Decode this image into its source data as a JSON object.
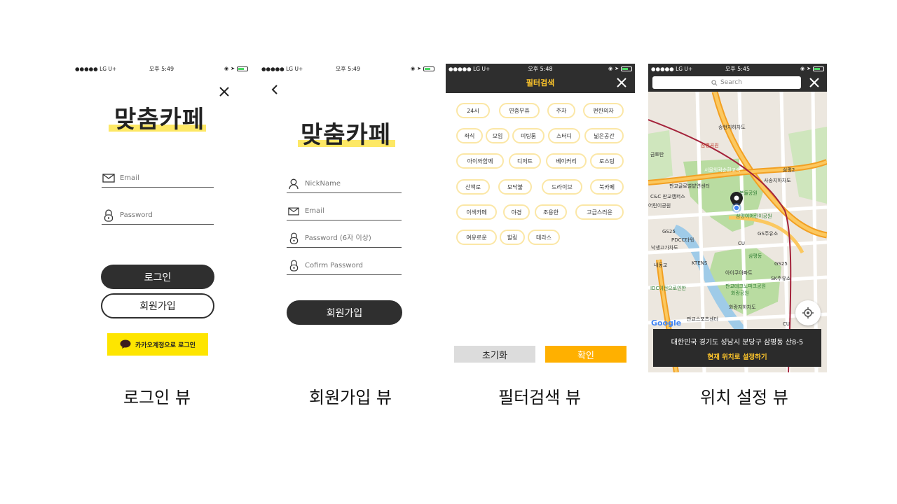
{
  "status": {
    "carrier": "●●●●● LG U+",
    "time_login": "오후 5:49",
    "time_signup": "오후 5:49",
    "time_filter": "오후 5:48",
    "time_map": "오후 5:45"
  },
  "login": {
    "logo": "맞춤카페",
    "email_placeholder": "Email",
    "password_placeholder": "Password",
    "login_label": "로그인",
    "signup_label": "회원가입",
    "kakao_label": "카카오계정으로 로그인",
    "caption": "로그인 뷰"
  },
  "signup": {
    "logo": "맞춤카페",
    "nickname_placeholder": "NickName",
    "email_placeholder": "Email",
    "password_placeholder": "Password (6자 이상)",
    "confirm_placeholder": "Cofirm Password",
    "signup_label": "회원가입",
    "caption": "회원가입 뷰"
  },
  "filter": {
    "title": "필터검색",
    "chips": [
      "24시",
      "연중무휴",
      "주차",
      "편한의자",
      "좌식",
      "모임",
      "미팅룸",
      "스터디",
      "넓은공간",
      "아이와함께",
      "디저트",
      "베이커리",
      "로스팅",
      "산책로",
      "모닥불",
      "드라이브",
      "북카페",
      "이색카페",
      "야경",
      "조용한",
      "고급스러운",
      "여유로운",
      "힐링",
      "테라스"
    ],
    "reset_label": "초기화",
    "ok_label": "확인",
    "caption": "필터검색 뷰"
  },
  "map": {
    "search_placeholder": "Search",
    "address": "대한민국 경기도 성남시 분당구 삼평동 산8-5",
    "set_label": "현재 위치로 설정하기",
    "google": "Google",
    "labels": [
      "송현지하차도",
      "삼평공원",
      "금토탄",
      "서울외곽순환고속",
      "삼평2",
      "사송지하차도",
      "판교글로벌밭연센터",
      "C&C 판교캠퍼스",
      "어린이공원",
      "봇들공원",
      "삼평이어린이공원",
      "GS25",
      "PDCC타워",
      "GS주유소",
      "CU",
      "낙생고가차도",
      "삼평동",
      "KTENS",
      "아이쿠아파트",
      "GS25",
      "내동교",
      "판교테크노파크공원",
      "SK주유소",
      "IDC이전으로인한",
      "화랑공원",
      "화랑지하차도",
      "판교스포츠센터",
      "CU"
    ],
    "caption": "위치 설정 뷰"
  },
  "colors": {
    "accent": "#ffb000",
    "dark": "#2e2e2e",
    "kakao": "#fee500",
    "chip_border": "#fbe7a6",
    "highlight": "#fde865"
  }
}
